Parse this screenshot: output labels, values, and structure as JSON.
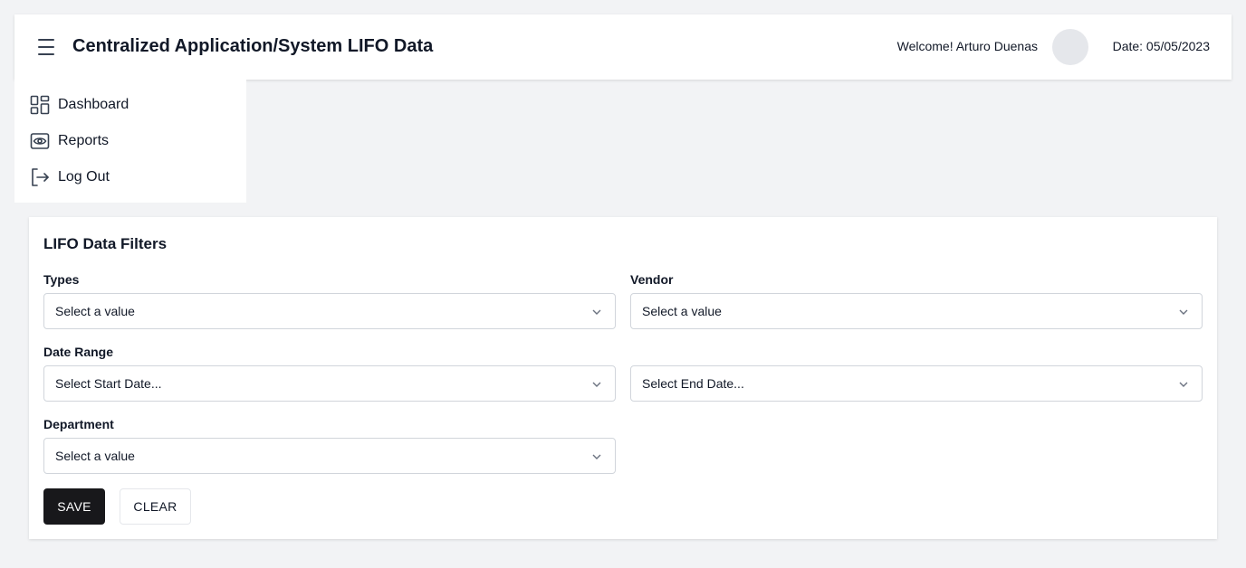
{
  "header": {
    "title": "Centralized Application/System LIFO Data",
    "welcome": "Welcome! Arturo Duenas",
    "date": "Date: 05/05/2023"
  },
  "sidebar": {
    "items": [
      {
        "label": "Dashboard",
        "icon": "dashboard-icon"
      },
      {
        "label": "Reports",
        "icon": "eye-icon"
      },
      {
        "label": "Log Out",
        "icon": "logout-icon"
      }
    ]
  },
  "filters": {
    "title": "LIFO Data Filters",
    "types": {
      "label": "Types",
      "value": "Select a value"
    },
    "vendor": {
      "label": "Vendor",
      "value": "Select a value"
    },
    "date_range": {
      "label": "Date Range",
      "start": "Select Start Date...",
      "end": "Select End Date..."
    },
    "department": {
      "label": "Department",
      "value": "Select a value"
    },
    "save_label": "SAVE",
    "clear_label": "CLEAR"
  }
}
